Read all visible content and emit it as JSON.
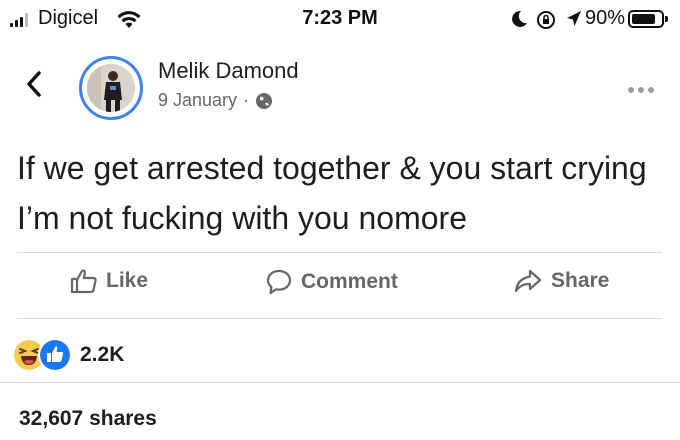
{
  "status_bar": {
    "carrier": "Digicel",
    "time": "7:23 PM",
    "battery_percent": "90%",
    "battery_level": 0.9
  },
  "header": {
    "back_icon": "chevron-left-icon",
    "author_name": "Melik Damond",
    "post_date": "9 January",
    "separator": "·",
    "privacy_icon": "globe-icon",
    "more_icon": "ellipsis-icon"
  },
  "post": {
    "text": "If we get arrested together & you start crying I’m not fucking with you nomore"
  },
  "actions": {
    "like_label": "Like",
    "comment_label": "Comment",
    "share_label": "Share"
  },
  "engagement": {
    "reaction_count": "2.2K",
    "shares_text": "32,607 shares"
  },
  "colors": {
    "accent_blue": "#1877f2",
    "avatar_ring": "#3f84e8",
    "haha_yellow": "#f7c94c",
    "muted_text": "#65676b"
  }
}
